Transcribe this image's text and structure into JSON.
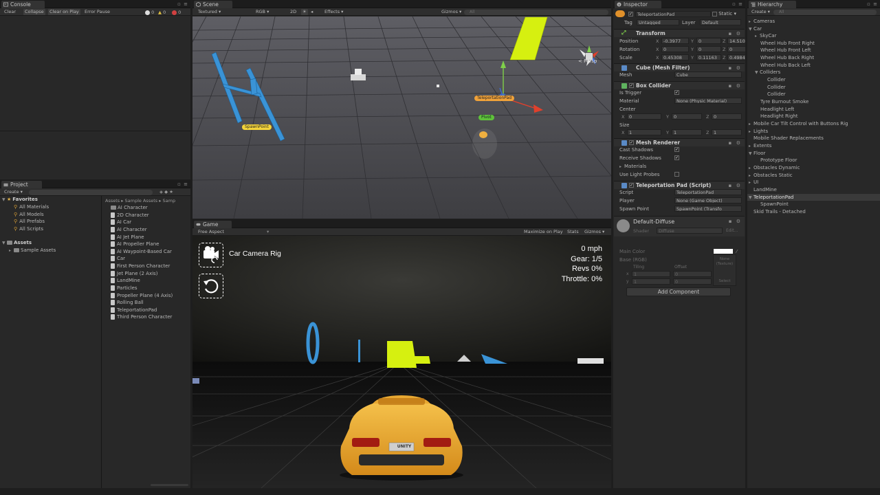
{
  "console": {
    "tab": "Console",
    "buttons": [
      "Clear",
      "Collapse",
      "Clear on Play",
      "Error Pause"
    ],
    "counts": {
      "info": "0",
      "warn": "0",
      "error": "0"
    }
  },
  "project": {
    "tab": "Project",
    "create": "Create",
    "favorites_title": "Favorites",
    "favorites": [
      "All Materials",
      "All Models",
      "All Prefabs",
      "All Scripts"
    ],
    "assets_title": "Assets",
    "assets_children": [
      "Sample Assets"
    ],
    "breadcrumb": "Assets ▸ Sample Assets ▸ Samp",
    "files": [
      "AI Character",
      "2D Character",
      "AI Car",
      "AI Character",
      "AI Jet Plane",
      "AI Propeller Plane",
      "AI Waypoint-Based Car",
      "Car",
      "First Person Character",
      "Jet Plane (2 Axis)",
      "LandMine",
      "Particles",
      "Propeller Plane (4 Axis)",
      "Rolling Ball",
      "TeleportationPad",
      "Third Person Character"
    ]
  },
  "scene": {
    "tab": "Scene",
    "toolbar": {
      "shading": "Textured",
      "color": "RGB",
      "mode2d": "2D",
      "effects": "Effects",
      "gizmos": "Gizmos",
      "search": "All"
    },
    "labels": {
      "spawn": "SpawnPoint",
      "pad": "TeleportationPad",
      "pivot": "Pivot",
      "persp": "< Persp"
    }
  },
  "game": {
    "tab": "Game",
    "aspect": "Free Aspect",
    "toolbar_right": [
      "Maximize on Play",
      "Stats",
      "Gizmos"
    ],
    "camera_label": "Car Camera Rig",
    "hud": {
      "speed": "0 mph",
      "gear": "Gear: 1/5",
      "revs": "Revs 0%",
      "throttle": "Throttle: 0%"
    },
    "plate": "UNITY"
  },
  "inspector": {
    "tab": "Inspector",
    "object_name": "TeleportationPad",
    "static_label": "Static",
    "tag_label": "Tag",
    "tag_value": "Untagged",
    "layer_label": "Layer",
    "layer_value": "Default",
    "transform": {
      "title": "Transform",
      "position_label": "Position",
      "position": {
        "x": "-0.3977",
        "y": "0",
        "z": "14.5109"
      },
      "rotation_label": "Rotation",
      "rotation": {
        "x": "0",
        "y": "0",
        "z": "0"
      },
      "scale_label": "Scale",
      "scale": {
        "x": "0.45308",
        "y": "0.11163",
        "z": "0.49842"
      }
    },
    "mesh_filter": {
      "title": "Cube (Mesh Filter)",
      "mesh_label": "Mesh",
      "mesh_value": "Cube"
    },
    "box_collider": {
      "title": "Box Collider",
      "is_trigger_label": "Is Trigger",
      "material_label": "Material",
      "material_value": "None (Physic Material)",
      "center_label": "Center",
      "center": {
        "x": "0",
        "y": "0",
        "z": "0"
      },
      "size_label": "Size",
      "size": {
        "x": "1",
        "y": "1",
        "z": "1"
      }
    },
    "mesh_renderer": {
      "title": "Mesh Renderer",
      "cast_label": "Cast Shadows",
      "receive_label": "Receive Shadows",
      "materials_label": "Materials",
      "probes_label": "Use Light Probes"
    },
    "script": {
      "title": "Teleportation Pad (Script)",
      "script_label": "Script",
      "script_value": "TeleportationPad",
      "player_label": "Player",
      "player_value": "None (Game Object)",
      "spawn_label": "Spawn Point",
      "spawn_value": "SpawnPoint (Transfo"
    },
    "material": {
      "name": "Default-Diffuse",
      "shader_label": "Shader",
      "shader_value": "Diffuse",
      "edit": "Edit...",
      "main_color": "Main Color",
      "base": "Base (RGB)",
      "tiling": "Tiling",
      "offset": "Offset",
      "x_label": "x",
      "y_label": "y",
      "tx": "1",
      "ty": "1",
      "ox": "0",
      "oy": "0",
      "texture": "None (Texture)",
      "select": "Select"
    },
    "add_component": "Add Component"
  },
  "hierarchy": {
    "tab": "Hierarchy",
    "create": "Create",
    "search": "All",
    "items": [
      {
        "label": "Cameras"
      },
      {
        "label": "Car"
      },
      {
        "label": "SkyCar"
      },
      {
        "label": "Wheel Hub Front Right"
      },
      {
        "label": "Wheel Hub Front Left"
      },
      {
        "label": "Wheel Hub Back Right"
      },
      {
        "label": "Wheel Hub Back Left"
      },
      {
        "label": "Colliders"
      },
      {
        "label": "Collider"
      },
      {
        "label": "Collider"
      },
      {
        "label": "Collider"
      },
      {
        "label": "Tyre Burnout Smoke"
      },
      {
        "label": "Headlight Left"
      },
      {
        "label": "Headlight Right"
      },
      {
        "label": "Mobile Car Tilt Control with Buttons Rig"
      },
      {
        "label": "Lights"
      },
      {
        "label": "Mobile Shader Replacements"
      },
      {
        "label": "Extents"
      },
      {
        "label": "Floor"
      },
      {
        "label": "Prototype Floor"
      },
      {
        "label": "Obstacles Dynamic"
      },
      {
        "label": "Obstacles Static"
      },
      {
        "label": "UI"
      },
      {
        "label": "LandMine"
      },
      {
        "label": "TeleportationPad"
      },
      {
        "label": "SpawnPoint"
      },
      {
        "label": "Skid Trails - Detached"
      }
    ]
  }
}
